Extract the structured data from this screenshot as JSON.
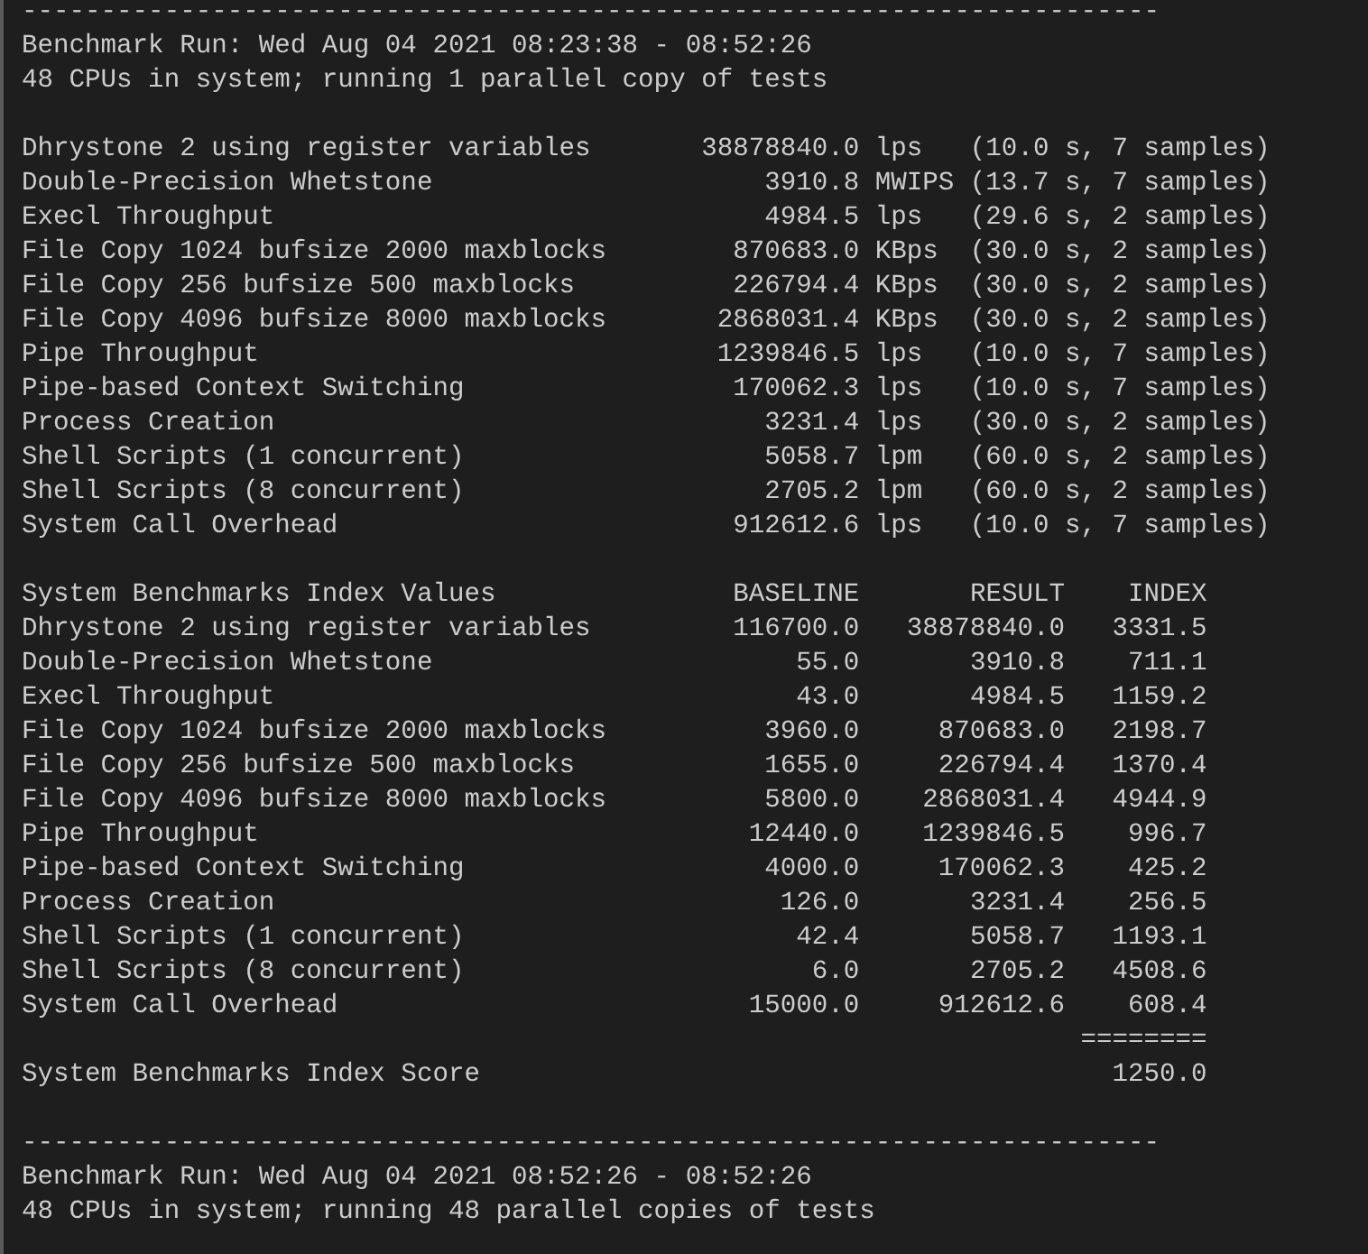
{
  "runs": [
    {
      "separator": "------------------------------------------------------------------------",
      "title": "Benchmark Run: Wed Aug 04 2021 08:23:38 - 08:52:26",
      "cpu_info": "48 CPUs in system; running 1 parallel copy of tests",
      "results": [
        {
          "name": "Dhrystone 2 using register variables",
          "value": "38878840.0",
          "unit": "lps",
          "timing": "(10.0 s, 7 samples)"
        },
        {
          "name": "Double-Precision Whetstone",
          "value": "3910.8",
          "unit": "MWIPS",
          "timing": "(13.7 s, 7 samples)"
        },
        {
          "name": "Execl Throughput",
          "value": "4984.5",
          "unit": "lps",
          "timing": "(29.6 s, 2 samples)"
        },
        {
          "name": "File Copy 1024 bufsize 2000 maxblocks",
          "value": "870683.0",
          "unit": "KBps",
          "timing": "(30.0 s, 2 samples)"
        },
        {
          "name": "File Copy 256 bufsize 500 maxblocks",
          "value": "226794.4",
          "unit": "KBps",
          "timing": "(30.0 s, 2 samples)"
        },
        {
          "name": "File Copy 4096 bufsize 8000 maxblocks",
          "value": "2868031.4",
          "unit": "KBps",
          "timing": "(30.0 s, 2 samples)"
        },
        {
          "name": "Pipe Throughput",
          "value": "1239846.5",
          "unit": "lps",
          "timing": "(10.0 s, 7 samples)"
        },
        {
          "name": "Pipe-based Context Switching",
          "value": "170062.3",
          "unit": "lps",
          "timing": "(10.0 s, 7 samples)"
        },
        {
          "name": "Process Creation",
          "value": "3231.4",
          "unit": "lps",
          "timing": "(30.0 s, 2 samples)"
        },
        {
          "name": "Shell Scripts (1 concurrent)",
          "value": "5058.7",
          "unit": "lpm",
          "timing": "(60.0 s, 2 samples)"
        },
        {
          "name": "Shell Scripts (8 concurrent)",
          "value": "2705.2",
          "unit": "lpm",
          "timing": "(60.0 s, 2 samples)"
        },
        {
          "name": "System Call Overhead",
          "value": "912612.6",
          "unit": "lps",
          "timing": "(10.0 s, 7 samples)"
        }
      ],
      "index": {
        "columns": [
          "System Benchmarks Index Values",
          "BASELINE",
          "RESULT",
          "INDEX"
        ],
        "rows": [
          {
            "name": "Dhrystone 2 using register variables",
            "baseline": "116700.0",
            "result": "38878840.0",
            "index": "3331.5"
          },
          {
            "name": "Double-Precision Whetstone",
            "baseline": "55.0",
            "result": "3910.8",
            "index": "711.1"
          },
          {
            "name": "Execl Throughput",
            "baseline": "43.0",
            "result": "4984.5",
            "index": "1159.2"
          },
          {
            "name": "File Copy 1024 bufsize 2000 maxblocks",
            "baseline": "3960.0",
            "result": "870683.0",
            "index": "2198.7"
          },
          {
            "name": "File Copy 256 bufsize 500 maxblocks",
            "baseline": "1655.0",
            "result": "226794.4",
            "index": "1370.4"
          },
          {
            "name": "File Copy 4096 bufsize 8000 maxblocks",
            "baseline": "5800.0",
            "result": "2868031.4",
            "index": "4944.9"
          },
          {
            "name": "Pipe Throughput",
            "baseline": "12440.0",
            "result": "1239846.5",
            "index": "996.7"
          },
          {
            "name": "Pipe-based Context Switching",
            "baseline": "4000.0",
            "result": "170062.3",
            "index": "425.2"
          },
          {
            "name": "Process Creation",
            "baseline": "126.0",
            "result": "3231.4",
            "index": "256.5"
          },
          {
            "name": "Shell Scripts (1 concurrent)",
            "baseline": "42.4",
            "result": "5058.7",
            "index": "1193.1"
          },
          {
            "name": "Shell Scripts (8 concurrent)",
            "baseline": "6.0",
            "result": "2705.2",
            "index": "4508.6"
          },
          {
            "name": "System Call Overhead",
            "baseline": "15000.0",
            "result": "912612.6",
            "index": "608.4"
          }
        ],
        "rule": "========",
        "score_label": "System Benchmarks Index Score",
        "score": "1250.0"
      }
    },
    {
      "separator": "------------------------------------------------------------------------",
      "title": "Benchmark Run: Wed Aug 04 2021 08:52:26 - 08:52:26",
      "cpu_info": "48 CPUs in system; running 48 parallel copies of tests"
    }
  ]
}
